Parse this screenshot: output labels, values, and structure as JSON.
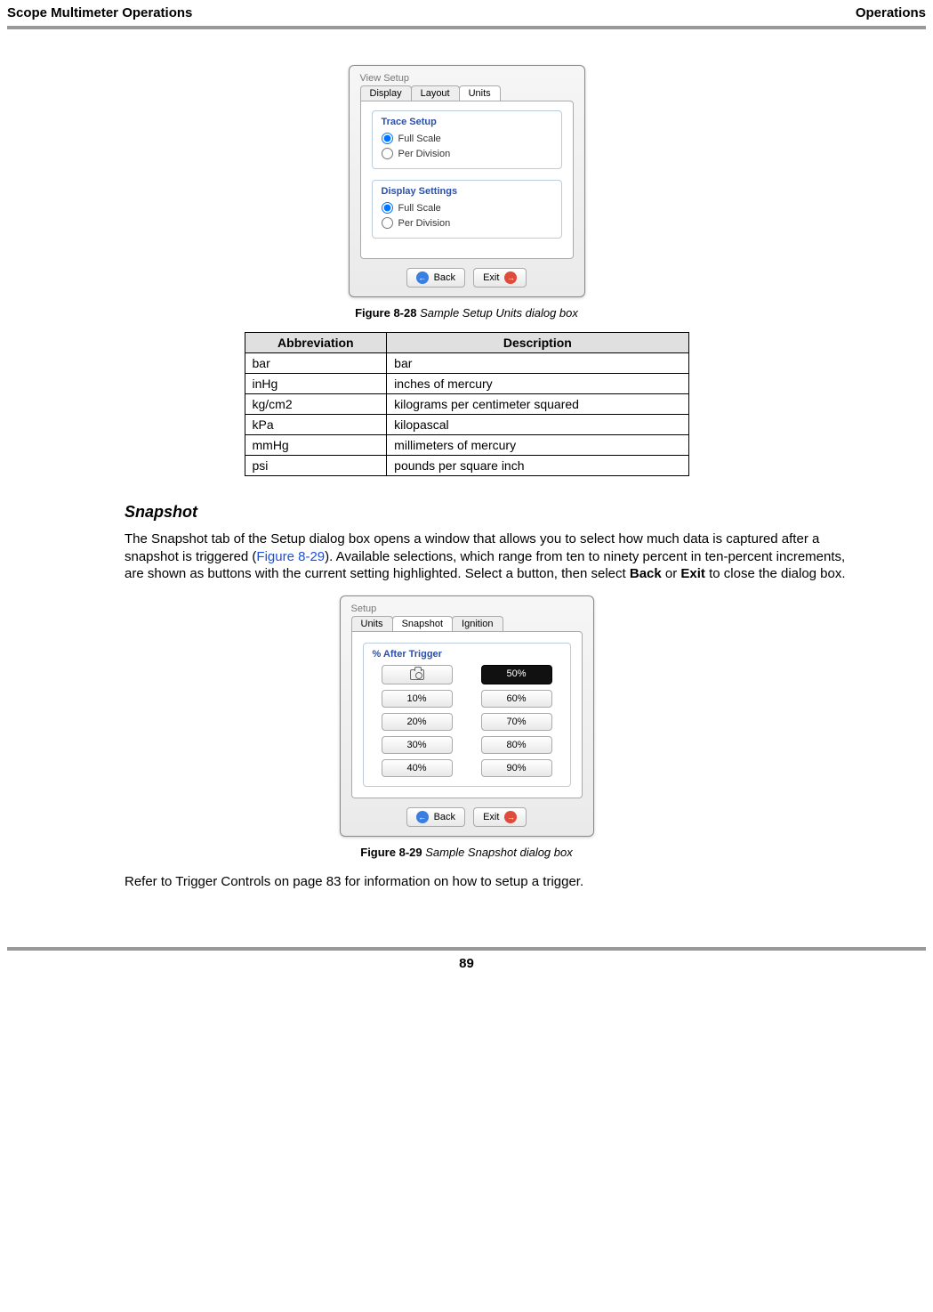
{
  "header": {
    "left": "Scope Multimeter Operations",
    "right": "Operations"
  },
  "fig28": {
    "caption_num": "Figure 8-28",
    "caption_desc": "Sample Setup Units dialog box",
    "title": "View Setup",
    "tabs": [
      "Display",
      "Layout",
      "Units"
    ],
    "active_tab": "Units",
    "trace_setup_title": "Trace Setup",
    "trace_options": [
      "Full Scale",
      "Per Division"
    ],
    "trace_selected": "Full Scale",
    "display_settings_title": "Display Settings",
    "display_options": [
      "Full Scale",
      "Per Division"
    ],
    "display_selected": "Full Scale",
    "back": "Back",
    "exit": "Exit"
  },
  "table": {
    "headers": [
      "Abbreviation",
      "Description"
    ],
    "rows": [
      [
        "bar",
        "bar"
      ],
      [
        "inHg",
        "inches of mercury"
      ],
      [
        "kg/cm2",
        "kilograms per centimeter squared"
      ],
      [
        "kPa",
        "kilopascal"
      ],
      [
        "mmHg",
        "millimeters of mercury"
      ],
      [
        "psi",
        "pounds per square inch"
      ]
    ]
  },
  "snapshot_heading": "Snapshot",
  "snapshot_para": {
    "p1": "The Snapshot tab of the Setup dialog box opens a window that allows you to select how much data is captured after a snapshot is triggered (",
    "link1": "Figure 8-29",
    "p2": "). Available selections, which range from ten to ninety percent in ten-percent increments, are shown as buttons with the current setting highlighted. Select a button, then select ",
    "b1": "Back",
    "p3": " or ",
    "b2": "Exit",
    "p4": " to close the dialog box."
  },
  "fig29": {
    "caption_num": "Figure 8-29",
    "caption_desc": "Sample Snapshot dialog box",
    "title": "Setup",
    "tabs": [
      "Units",
      "Snapshot",
      "Ignition"
    ],
    "active_tab": "Snapshot",
    "group_title": "% After Trigger",
    "options": [
      "10%",
      "20%",
      "30%",
      "40%",
      "50%",
      "60%",
      "70%",
      "80%",
      "90%"
    ],
    "selected": "50%",
    "back": "Back",
    "exit": "Exit"
  },
  "refer_para": {
    "p1": "Refer to ",
    "link1": "Trigger Controls",
    "p2": " on page 83 for information on how to setup a trigger."
  },
  "page_number": "89"
}
